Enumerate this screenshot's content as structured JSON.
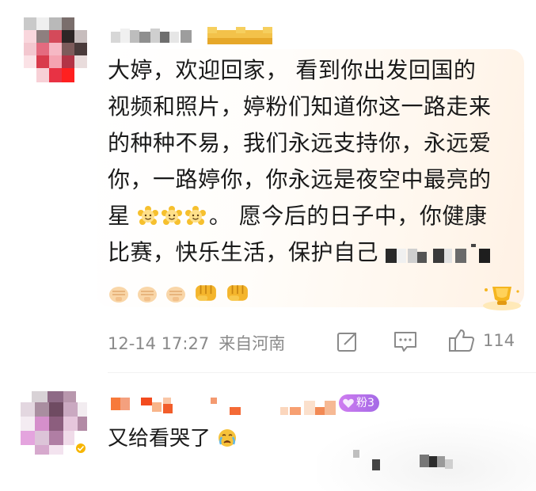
{
  "comment1": {
    "body_lines": [
      "大婷，欢迎回家，  看到你出发回国的",
      "视频和照片，婷粉们知道你这一路走来",
      "的种种不易，我们永远支持你，永远爱",
      "你，一路婷你，你永远是夜空中最亮的"
    ],
    "line5_a": "星",
    "line5_b": "。 愿今后的日子中，你健康",
    "line6": "比赛，快乐生活，保护自己",
    "meta": {
      "date": "12-14 17:27",
      "location": "来自河南"
    },
    "likes": "114",
    "icons": {
      "avatar": "pixelated-avatar",
      "name": "pixelated-username",
      "crown": "gold-crown-badge-icon",
      "emoji_sun": "smiling-sun-emoji-icon",
      "emoji_fist": "fist-emoji-icon",
      "emoji_punch": "oncoming-fist-emoji-icon",
      "trophy": "gold-trophy-badge-icon",
      "share": "share-icon",
      "comment": "comment-icon",
      "like": "thumbs-up-icon"
    }
  },
  "comment2": {
    "fan_level": "3",
    "fan_label": "粉",
    "body": "又给看哭了",
    "icons": {
      "avatar": "pixelated-avatar",
      "verified": "verified-badge-icon",
      "crying": "crying-face-emoji-icon",
      "heart": "heart-icon"
    }
  },
  "colors": {
    "text": "#1a1a1a",
    "meta": "#8a8a8a",
    "bubble": "#fff3e6",
    "fan_badge": "#b46fea",
    "gold": "#f2b01e"
  }
}
